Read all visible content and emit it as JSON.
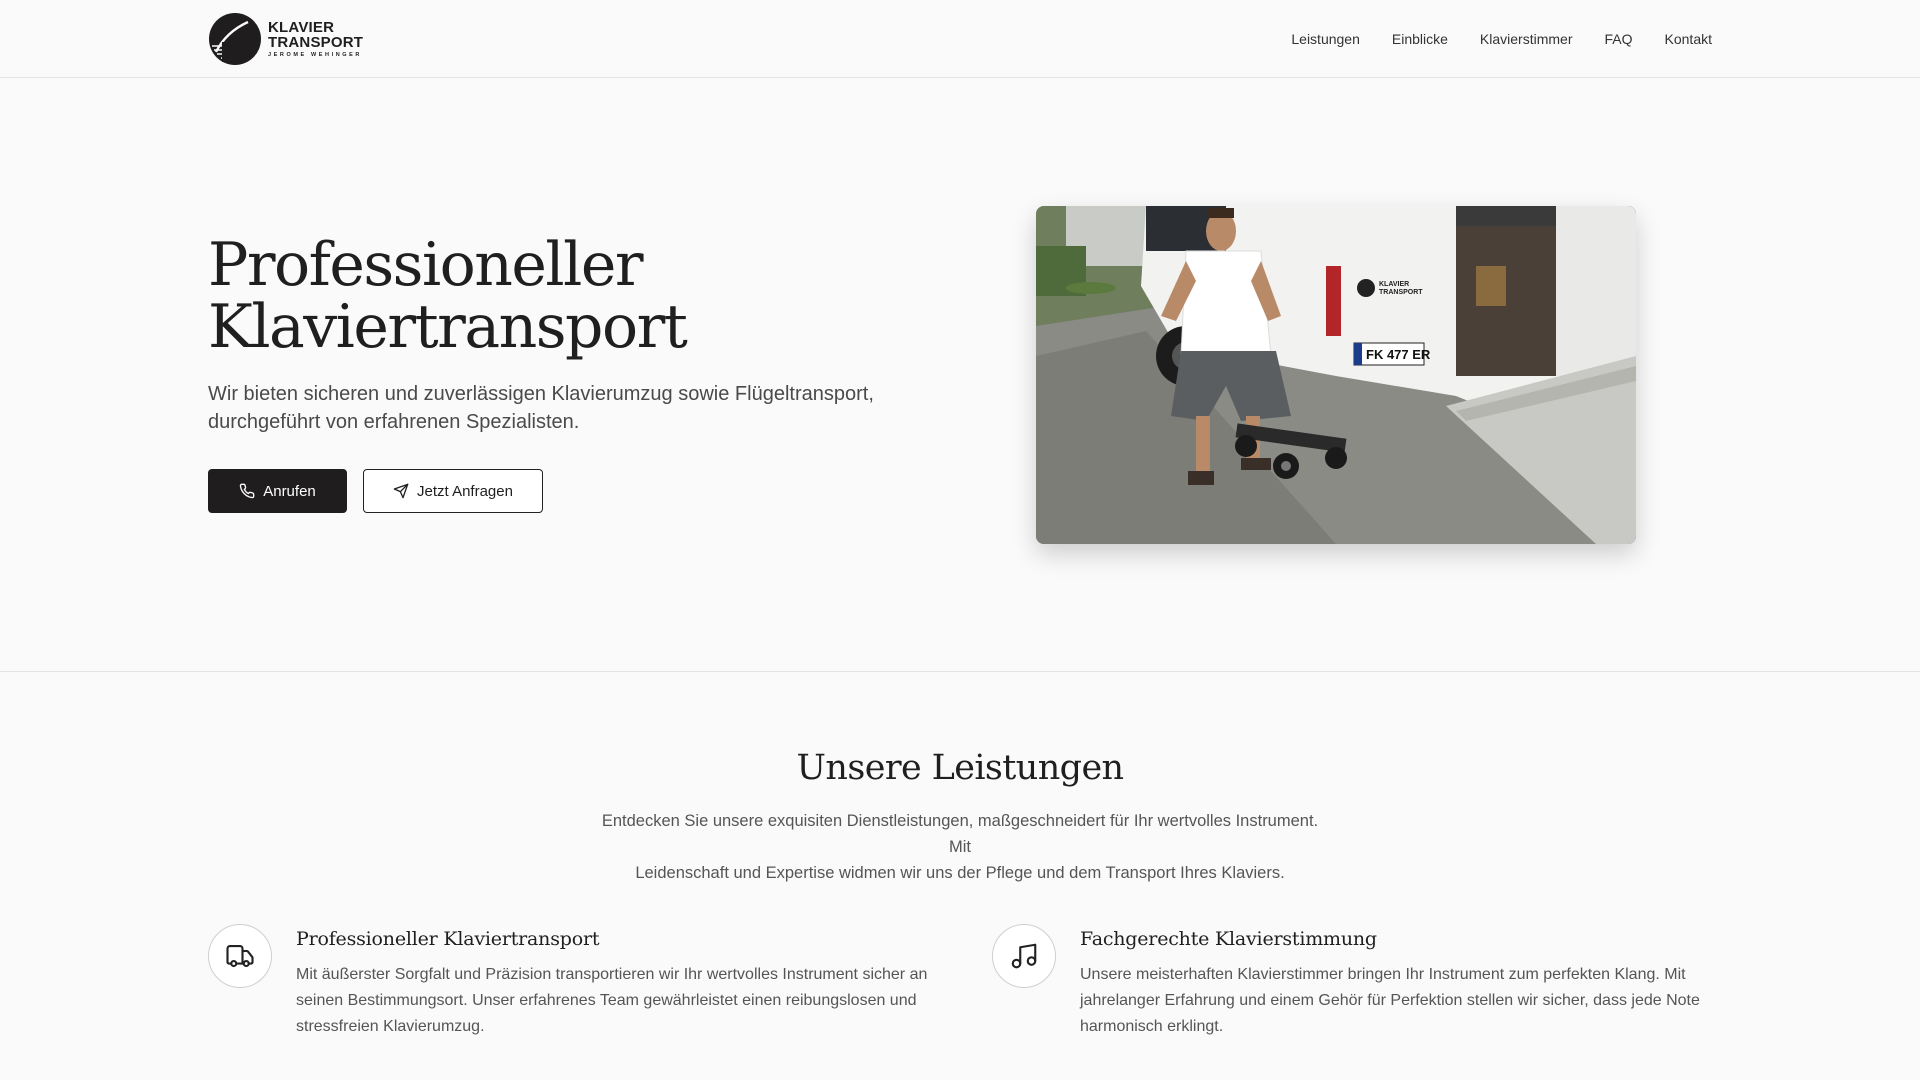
{
  "header": {
    "logo": {
      "line1": "KLAVIER",
      "line2": "TRANSPORT",
      "subline": "JEROME WEHINGER"
    },
    "nav": [
      {
        "label": "Leistungen"
      },
      {
        "label": "Einblicke"
      },
      {
        "label": "Klavierstimmer"
      },
      {
        "label": "FAQ"
      },
      {
        "label": "Kontakt"
      }
    ]
  },
  "hero": {
    "title_line1": "Professioneller",
    "title_line2": "Klaviertransport",
    "subtitle_line1": "Wir bieten sicheren und zuverlässigen Klavierumzug sowie Flügeltransport,",
    "subtitle_line2": "durchgeführt von erfahrenen Spezialisten.",
    "primary_button": {
      "label": "Anrufen",
      "icon": "phone-icon"
    },
    "secondary_button": {
      "label": "Jetzt Anfragen",
      "icon": "send-icon"
    },
    "image": {
      "van_logo_line1": "KLAVIER",
      "van_logo_line2": "TRANSPORT",
      "license_plate": "FK 477 ER"
    }
  },
  "services": {
    "title": "Unsere Leistungen",
    "subtitle_line1": "Entdecken Sie unsere exquisiten Dienstleistungen, maßgeschneidert für Ihr wertvolles Instrument. Mit",
    "subtitle_line2": "Leidenschaft und Expertise widmen wir uns der Pflege und dem Transport Ihres Klaviers.",
    "items": [
      {
        "icon": "truck-icon",
        "title": "Professioneller Klaviertransport",
        "text_line1": "Mit äußerster Sorgfalt und Präzision transportieren wir Ihr wertvolles Instrument sicher an",
        "text_line2": "seinen Bestimmungsort. Unser erfahrenes Team gewährleistet einen reibungslosen und",
        "text_line3": "stressfreien Klavierumzug."
      },
      {
        "icon": "music-note-icon",
        "title": "Fachgerechte Klavierstimmung",
        "text_line1": "Unsere meisterhaften Klavierstimmer bringen Ihr Instrument zum perfekten Klang. Mit",
        "text_line2": "jahrelanger Erfahrung und einem Gehör für Perfektion stellen wir sicher, dass jede Note",
        "text_line3": "harmonisch erklingt."
      }
    ]
  },
  "colors": {
    "background": "#fafafa",
    "primary_button": "#1f1d1e",
    "text": "#1f1f1f",
    "muted_text": "#555555",
    "border": "#e5e5e5"
  }
}
